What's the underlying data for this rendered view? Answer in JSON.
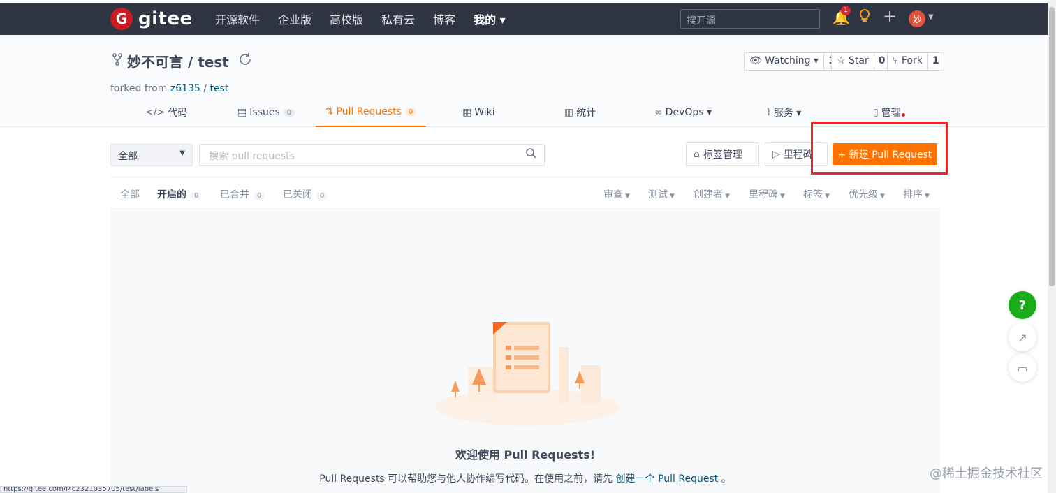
{
  "topbar": {
    "logo_letter": "G",
    "logo_text": "gitee",
    "nav": [
      "开源软件",
      "企业版",
      "高校版",
      "私有云",
      "博客",
      "我的 ▾"
    ],
    "search_placeholder": "搜开源",
    "notification_count": "1",
    "avatar_text": "妙"
  },
  "repo": {
    "title": "妙不可言 / test",
    "forked_prefix": "forked from",
    "forked_owner": "z6135",
    "forked_sep": "/",
    "forked_repo": "test",
    "watching_label": "Watching ▾",
    "watching_count": "1",
    "star_label": "Star",
    "star_count": "0",
    "fork_label": "Fork",
    "fork_count": "1"
  },
  "tabs": {
    "code": "代码",
    "issues": "Issues",
    "issues_count": "0",
    "pulls": "Pull Requests",
    "pulls_count": "0",
    "wiki": "Wiki",
    "stats": "统计",
    "devops": "DevOps ▾",
    "services": "服务 ▾",
    "manage": "管理"
  },
  "toolbar": {
    "filter_value": "全部",
    "search_placeholder": "搜索 pull requests",
    "labels_button": "标签管理",
    "milestones_button": "里程碑",
    "new_pr_button": "+ 新建 Pull Request"
  },
  "state_tabs": {
    "all": "全部",
    "open": "开启的",
    "open_count": "0",
    "merged": "已合并",
    "merged_count": "0",
    "closed": "已关闭",
    "closed_count": "0"
  },
  "filters": [
    "审查",
    "测试",
    "创建者",
    "里程碑",
    "标签",
    "优先级",
    "排序"
  ],
  "empty": {
    "title": "欢迎使用 Pull Requests!",
    "text_before": "Pull Requests 可以帮助您与他人协作编写代码。在使用之前，请先",
    "link": "创建一个 Pull Request",
    "text_after": "。"
  },
  "floating": {
    "help": "?"
  },
  "watermark": "@稀土掘金技术社区",
  "status_url": "https://gitee.com/Mc2321035705/test/labels"
}
